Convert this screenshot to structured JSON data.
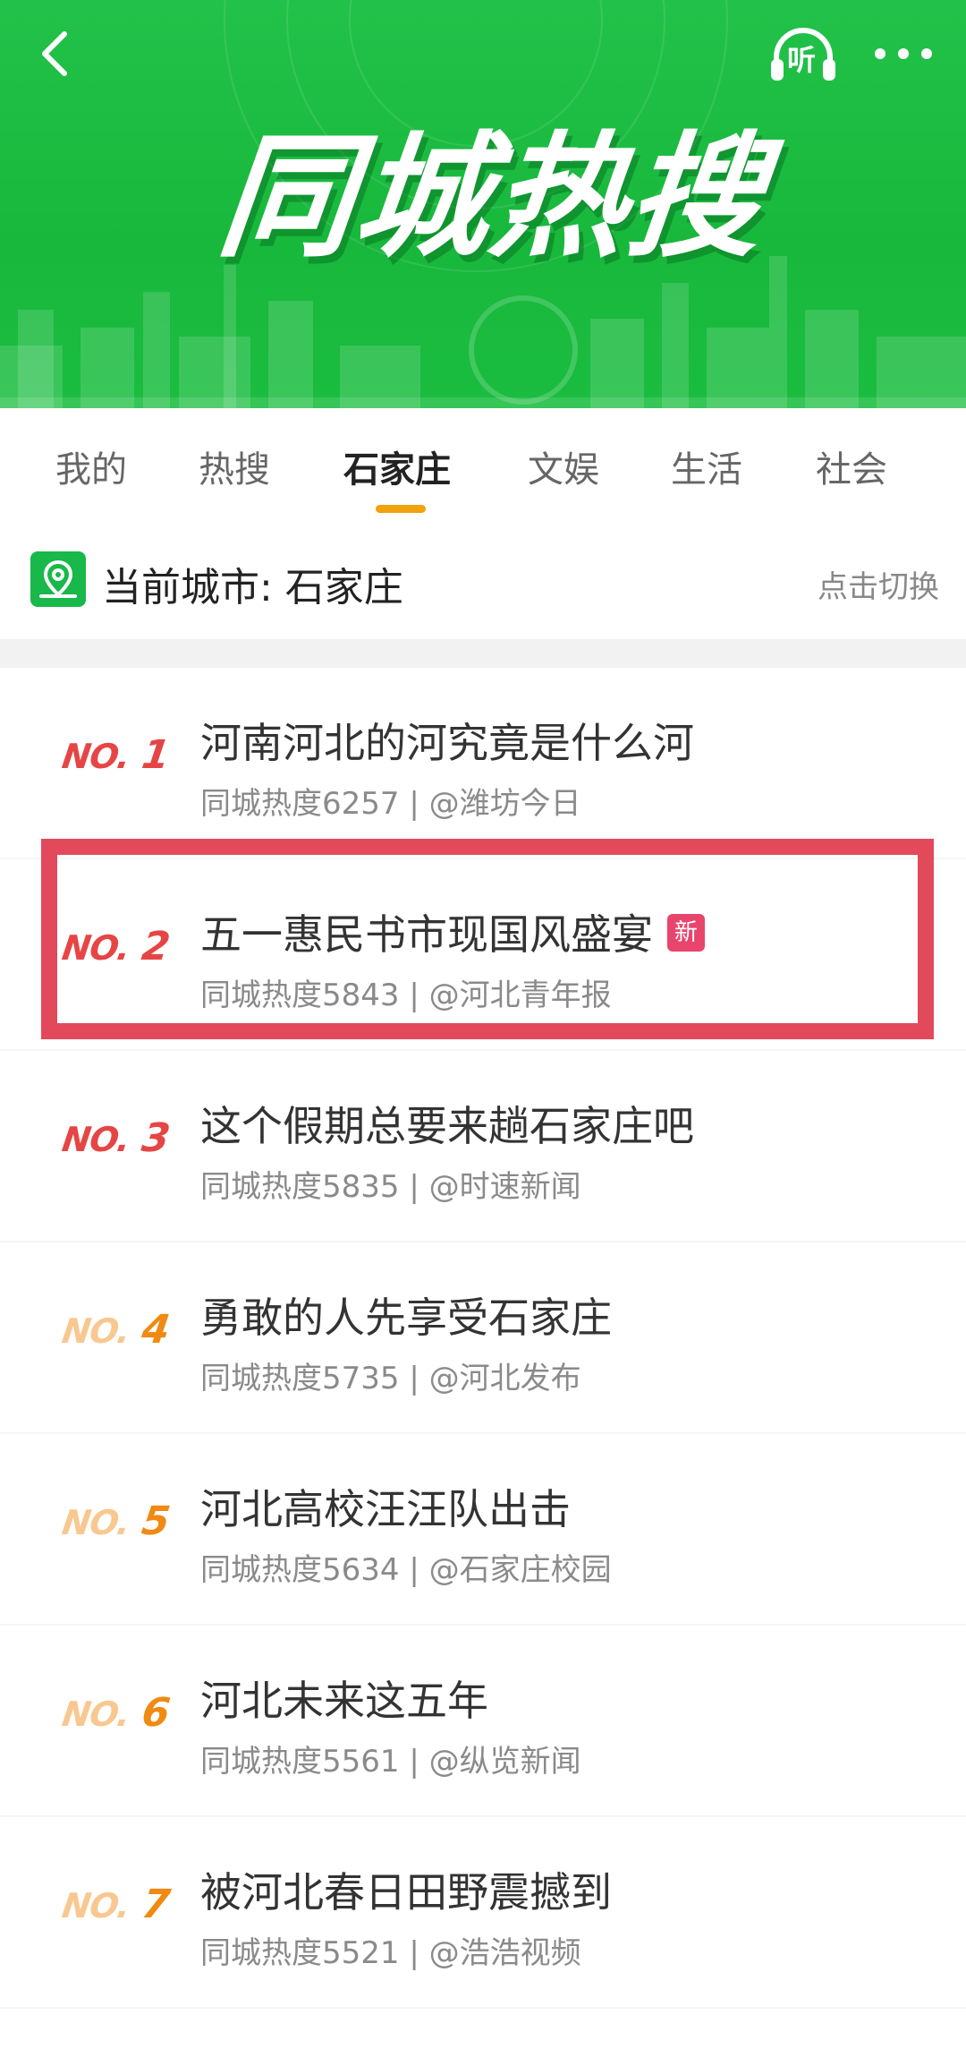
{
  "header": {
    "title": "同城热搜",
    "listen_label": "听"
  },
  "tabs": [
    {
      "label": "我的"
    },
    {
      "label": "热搜"
    },
    {
      "label": "石家庄",
      "active": true
    },
    {
      "label": "文娱"
    },
    {
      "label": "生活"
    },
    {
      "label": "社会"
    }
  ],
  "city_bar": {
    "label": "当前城市: 石家庄",
    "switch_label": "点击切换"
  },
  "list": [
    {
      "rank_prefix": "NO.",
      "rank": "1",
      "title": "河南河北的河究竟是什么河",
      "meta": "同城热度6257 | @潍坊今日"
    },
    {
      "rank_prefix": "NO.",
      "rank": "2",
      "title": "五一惠民书市现国风盛宴",
      "badge": "新",
      "meta": "同城热度5843 | @河北青年报"
    },
    {
      "rank_prefix": "NO.",
      "rank": "3",
      "title": "这个假期总要来趟石家庄吧",
      "meta": "同城热度5835 | @时速新闻"
    },
    {
      "rank_prefix": "NO.",
      "rank": "4",
      "title": "勇敢的人先享受石家庄",
      "meta": "同城热度5735 | @河北发布"
    },
    {
      "rank_prefix": "NO.",
      "rank": "5",
      "title": "河北高校汪汪队出击",
      "meta": "同城热度5634 | @石家庄校园"
    },
    {
      "rank_prefix": "NO.",
      "rank": "6",
      "title": "河北未来这五年",
      "meta": "同城热度5561 | @纵览新闻"
    },
    {
      "rank_prefix": "NO.",
      "rank": "7",
      "title": "被河北春日田野震撼到",
      "meta": "同城热度5521 | @浩浩视频"
    }
  ],
  "colors": {
    "banner_green": "#1bbd40",
    "accent_orange": "#f2a20c",
    "rank_red": "#e64545",
    "rank_orange": "#f08a12",
    "highlight_red": "#e2495a",
    "badge_pink": "#e8456d"
  }
}
